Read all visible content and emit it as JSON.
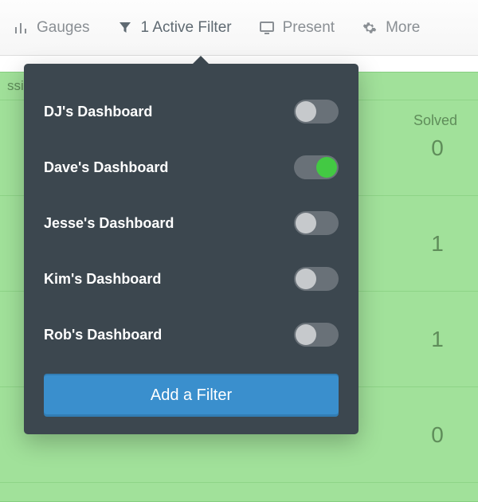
{
  "toolbar": {
    "gauges_label": "Gauges",
    "filter_label": "1 Active Filter",
    "present_label": "Present",
    "more_label": "More"
  },
  "content": {
    "left_header_truncated": "ssi",
    "solved_header": "Solved",
    "rows": [
      "0",
      "1",
      "1",
      "0"
    ]
  },
  "filter_panel": {
    "items": [
      {
        "label": "DJ's Dashboard",
        "on": false
      },
      {
        "label": "Dave's Dashboard",
        "on": true
      },
      {
        "label": "Jesse's Dashboard",
        "on": false
      },
      {
        "label": "Kim's Dashboard",
        "on": false
      },
      {
        "label": "Rob's Dashboard",
        "on": false
      }
    ],
    "add_button": "Add a Filter"
  }
}
